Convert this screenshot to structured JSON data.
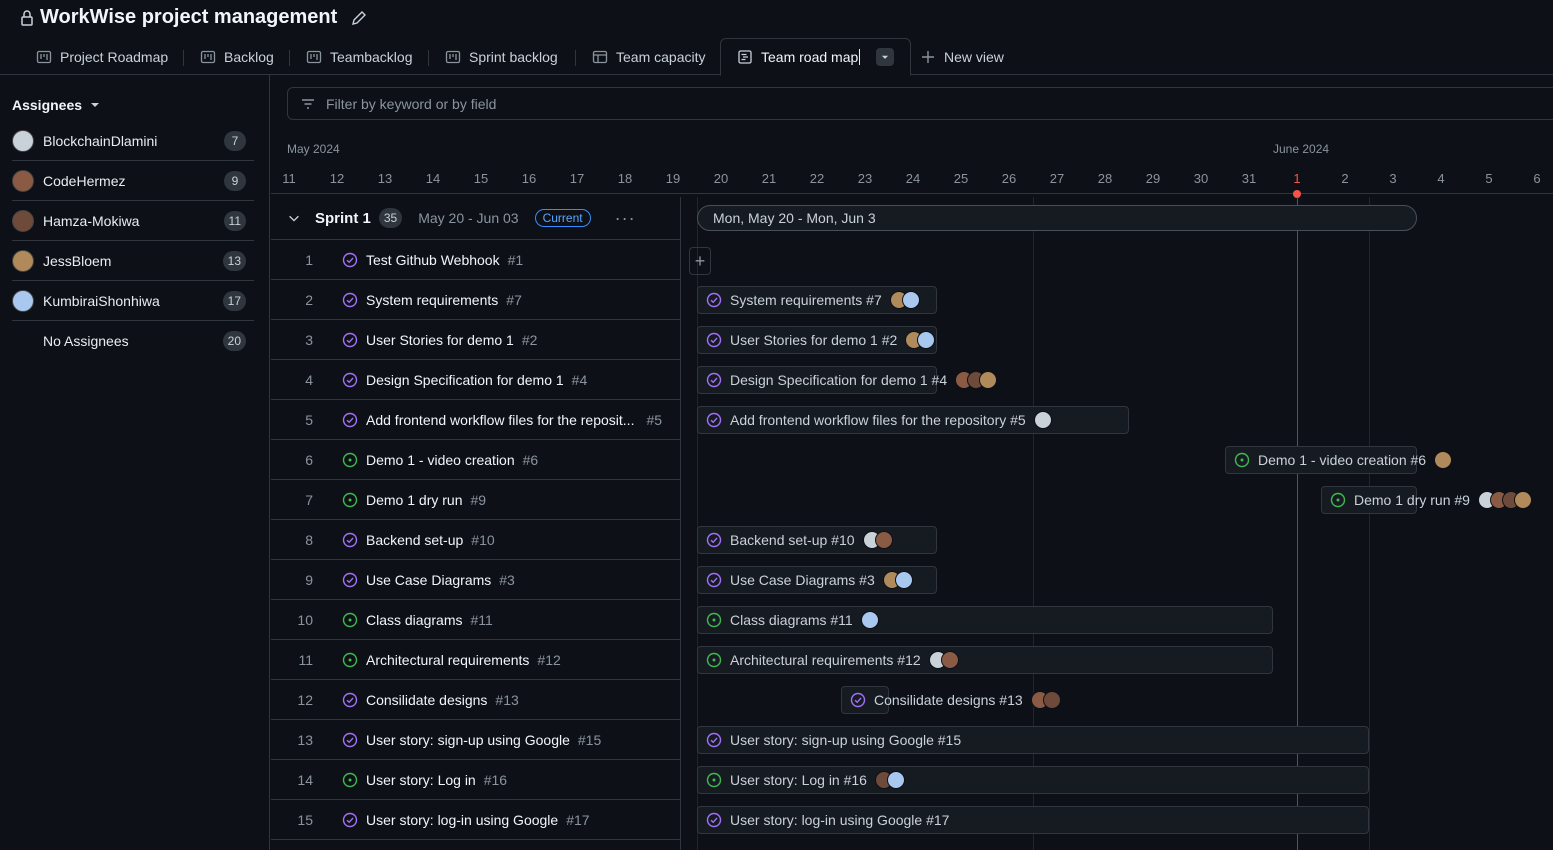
{
  "app": {
    "title": "WorkWise project management"
  },
  "tabs": [
    {
      "label": "Project Roadmap",
      "icon": "board-icon"
    },
    {
      "label": "Backlog",
      "icon": "board-icon"
    },
    {
      "label": "Teambacklog",
      "icon": "board-icon"
    },
    {
      "label": "Sprint backlog",
      "icon": "board-icon"
    },
    {
      "label": "Team capacity",
      "icon": "table-icon"
    },
    {
      "label": "Team road map",
      "icon": "roadmap-icon",
      "active": true
    }
  ],
  "new_view": "New view",
  "sidebar": {
    "heading": "Assignees",
    "items": [
      {
        "name": "BlockchainDlamini",
        "count": "7",
        "color": "#c9d1d9"
      },
      {
        "name": "CodeHermez",
        "count": "9",
        "color": "#8a5a44"
      },
      {
        "name": "Hamza-Mokiwa",
        "count": "11",
        "color": "#6e4a3a"
      },
      {
        "name": "JessBloem",
        "count": "13",
        "color": "#b08a5a"
      },
      {
        "name": "KumbiraiShonhiwa",
        "count": "17",
        "color": "#a8c8f0"
      },
      {
        "name": "No Assignees",
        "count": "20",
        "color": ""
      }
    ]
  },
  "filter": {
    "placeholder": "Filter by keyword or by field"
  },
  "timeline": {
    "months": [
      "May 2024",
      "June 2024"
    ],
    "days": [
      "11",
      "12",
      "13",
      "14",
      "15",
      "16",
      "17",
      "18",
      "19",
      "20",
      "21",
      "22",
      "23",
      "24",
      "25",
      "26",
      "27",
      "28",
      "29",
      "30",
      "31",
      "1",
      "2",
      "3",
      "4",
      "5",
      "6"
    ],
    "today": "1"
  },
  "sprint": {
    "name": "Sprint 1",
    "count": "35",
    "dates": "May 20 - Jun 03",
    "badge": "Current",
    "range_label": "Mon, May 20 - Mon, Jun 3"
  },
  "rows": [
    {
      "num": "1",
      "title": "Test Github Webhook",
      "id": "#1",
      "status": "closed"
    },
    {
      "num": "2",
      "title": "System requirements",
      "id": "#7",
      "status": "closed"
    },
    {
      "num": "3",
      "title": "User Stories for demo 1",
      "id": "#2",
      "status": "closed"
    },
    {
      "num": "4",
      "title": "Design Specification for demo 1",
      "id": "#4",
      "status": "closed"
    },
    {
      "num": "5",
      "title": "Add frontend workflow files for the reposit...",
      "id": "#5",
      "status": "closed"
    },
    {
      "num": "6",
      "title": "Demo 1 - video creation",
      "id": "#6",
      "status": "open"
    },
    {
      "num": "7",
      "title": "Demo 1 dry run",
      "id": "#9",
      "status": "open"
    },
    {
      "num": "8",
      "title": "Backend set-up",
      "id": "#10",
      "status": "closed"
    },
    {
      "num": "9",
      "title": "Use Case Diagrams",
      "id": "#3",
      "status": "closed"
    },
    {
      "num": "10",
      "title": "Class diagrams",
      "id": "#11",
      "status": "open"
    },
    {
      "num": "11",
      "title": "Architectural requirements",
      "id": "#12",
      "status": "open"
    },
    {
      "num": "12",
      "title": "Consilidate designs",
      "id": "#13",
      "status": "closed"
    },
    {
      "num": "13",
      "title": "User story: sign-up using Google",
      "id": "#15",
      "status": "closed"
    },
    {
      "num": "14",
      "title": "User story: Log in",
      "id": "#16",
      "status": "open"
    },
    {
      "num": "15",
      "title": "User story: log-in using Google",
      "id": "#17",
      "status": "closed"
    }
  ],
  "bars": [
    {
      "row": 2,
      "label": "System requirements #7",
      "status": "closed",
      "avatars": [
        "#b08a5a",
        "#a8c8f0"
      ]
    },
    {
      "row": 3,
      "label": "User Stories for demo 1 #2",
      "status": "closed",
      "avatars": [
        "#b08a5a",
        "#a8c8f0"
      ]
    },
    {
      "row": 4,
      "label": "Design Specification for demo 1 #4",
      "status": "closed",
      "avatars": [
        "#8a5a44",
        "#6e4a3a",
        "#b08a5a"
      ]
    },
    {
      "row": 5,
      "label": "Add frontend workflow files for the repository #5",
      "status": "closed",
      "avatars": [
        "#c9d1d9"
      ]
    },
    {
      "row": 6,
      "label": "Demo 1 - video creation #6",
      "status": "open",
      "avatars": [
        "#b08a5a"
      ]
    },
    {
      "row": 7,
      "label": "Demo 1 dry run #9",
      "status": "open",
      "avatars": [
        "#c9d1d9",
        "#8a5a44",
        "#6e4a3a",
        "#b08a5a"
      ]
    },
    {
      "row": 8,
      "label": "Backend set-up #10",
      "status": "closed",
      "avatars": [
        "#c9d1d9",
        "#8a5a44"
      ]
    },
    {
      "row": 9,
      "label": "Use Case Diagrams #3",
      "status": "closed",
      "avatars": [
        "#b08a5a",
        "#a8c8f0"
      ]
    },
    {
      "row": 10,
      "label": "Class diagrams #11",
      "status": "open",
      "avatars": [
        "#a8c8f0"
      ]
    },
    {
      "row": 11,
      "label": "Architectural requirements #12",
      "status": "open",
      "avatars": [
        "#c9d1d9",
        "#8a5a44"
      ]
    },
    {
      "row": 12,
      "label": "Consilidate designs #13",
      "status": "closed",
      "avatars": [
        "#8a5a44",
        "#6e4a3a"
      ]
    },
    {
      "row": 13,
      "label": "User story: sign-up using Google #15",
      "status": "closed",
      "avatars": []
    },
    {
      "row": 14,
      "label": "User story: Log in #16",
      "status": "open",
      "avatars": [
        "#6e4a3a",
        "#a8c8f0"
      ]
    },
    {
      "row": 15,
      "label": "User story: log-in using Google #17",
      "status": "closed",
      "avatars": []
    }
  ],
  "colors": {
    "open": "#3fb950",
    "closed": "#a371f7",
    "today": "#f85149",
    "accent": "#58a6ff"
  }
}
